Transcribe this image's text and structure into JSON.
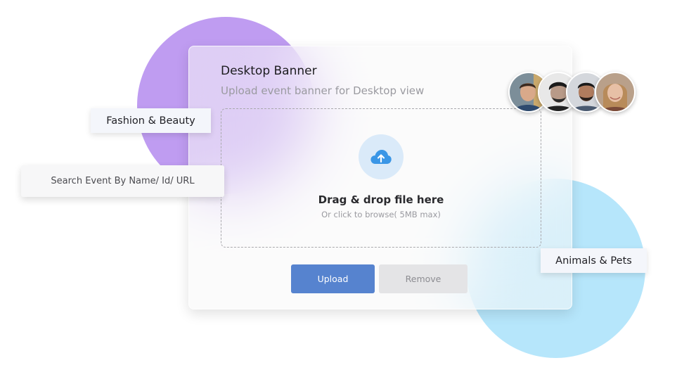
{
  "card": {
    "title": "Desktop Banner",
    "subtitle": "Upload event banner for Desktop view"
  },
  "dropzone": {
    "icon": "cloud-upload-icon",
    "title": "Drag & drop file here",
    "subtitle": "Or click to browse( 5MB max)"
  },
  "buttons": {
    "upload_label": "Upload",
    "remove_label": "Remove"
  },
  "tags": {
    "fashion": "Fashion & Beauty",
    "animals": "Animals & Pets"
  },
  "search": {
    "placeholder": "Search Event By Name/ Id/ URL"
  },
  "avatars": [
    {
      "name": "avatar-1",
      "bg": "#6b7f8f"
    },
    {
      "name": "avatar-2",
      "bg": "#2a2a2a"
    },
    {
      "name": "avatar-3",
      "bg": "#c9ccd1"
    },
    {
      "name": "avatar-4",
      "bg": "#c7a98b"
    }
  ],
  "colors": {
    "accent": "#5683cf",
    "purple_blob": "#bf9cf1",
    "blue_blob": "#b6e6fb",
    "upload_icon": "#3a96e6"
  }
}
